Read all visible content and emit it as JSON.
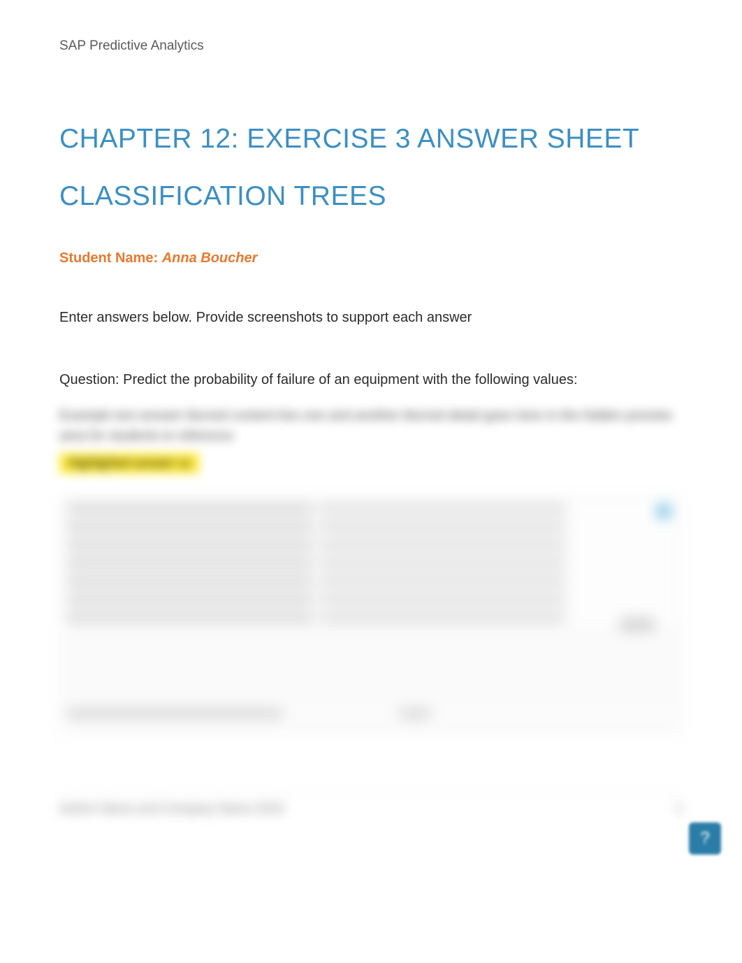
{
  "header": {
    "subject": "SAP Predictive Analytics"
  },
  "title": {
    "line1": "CHAPTER 12: EXERCISE 3 ANSWER SHEET",
    "line2": "CLASSIFICATION TREES"
  },
  "student": {
    "label": "Student Name: ",
    "name": "Anna Boucher"
  },
  "instructions": "Enter answers below. Provide screenshots to support each answer",
  "question": "Question: Predict the probability of failure of an equipment with the following values:",
  "blurred_answer_lines": "Example text answer blurred content line one and another blurred detail goes here in the hidden preview area for students to reference",
  "highlighted_blur": "Highlighted answer xx",
  "footer": {
    "left": "Author Name and Company Name 2019",
    "right": "1"
  },
  "help_icon": "?"
}
